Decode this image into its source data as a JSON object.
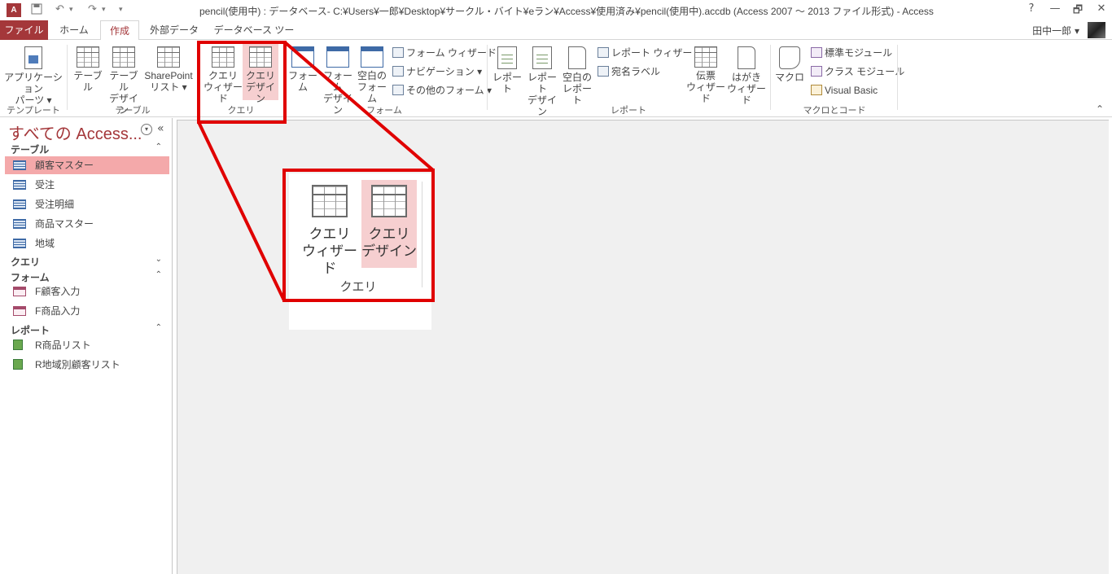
{
  "titlebar": {
    "app_icon": "A",
    "title": "pencil(使用中) : データベース- C:¥Users¥一郎¥Desktop¥サークル・バイト¥eラン¥Access¥使用済み¥pencil(使用中).accdb (Access 2007 ～ 2013 ファイル形式) - Access",
    "save_icon": "save-icon",
    "undo_icon": "undo-icon",
    "redo_icon": "redo-icon",
    "help": "?",
    "restore": "🗗",
    "minimize": "—",
    "close": "✕"
  },
  "tabs": [
    {
      "label": "ファイル"
    },
    {
      "label": "ホーム"
    },
    {
      "label": "作成"
    },
    {
      "label": "外部データ"
    },
    {
      "label": "データベース ツール"
    }
  ],
  "user": {
    "name": "田中一郎 ▾"
  },
  "ribbon": {
    "groups": {
      "template": "テンプレート",
      "table": "テーブル",
      "query": "クエリ",
      "form": "フォーム",
      "report": "レポート",
      "macro": "マクロとコード"
    },
    "app_parts": {
      "line1": "アプリケーション",
      "line2": "パーツ ▾"
    },
    "table": {
      "line1": "テーブル"
    },
    "table_design": {
      "line1": "テーブル",
      "line2": "デザイン"
    },
    "sharepoint": {
      "line1": "SharePoint",
      "line2": "リスト ▾"
    },
    "query_wizard": {
      "line1": "クエリ",
      "line2": "ウィザード"
    },
    "query_design": {
      "line1": "クエリ",
      "line2": "デザイン"
    },
    "form": {
      "line1": "フォーム"
    },
    "form_design": {
      "line1": "フォーム",
      "line2": "デザイン"
    },
    "blank_form": {
      "line1": "空白の",
      "line2": "フォーム"
    },
    "form_wizard": "フォーム ウィザード",
    "navigation": "ナビゲーション ▾",
    "more_forms": "その他のフォーム ▾",
    "report": {
      "line1": "レポート"
    },
    "report_design": {
      "line1": "レポート",
      "line2": "デザイン"
    },
    "blank_report": {
      "line1": "空白の",
      "line2": "レポート"
    },
    "report_wizard": "レポート ウィザード",
    "labels": "宛名ラベル",
    "slip_wizard": {
      "line1": "伝票",
      "line2": "ウィザード"
    },
    "postcard_wizard": {
      "line1": "はがき",
      "line2": "ウィザード"
    },
    "macro": {
      "line1": "マクロ"
    },
    "module": "標準モジュール",
    "class_module": "クラス モジュール",
    "visual_basic": "Visual Basic",
    "collapse": "⌃"
  },
  "navpane": {
    "title": "すべての Access...",
    "menu": "▾",
    "shutter": "«",
    "groups": [
      {
        "label": "テーブル",
        "chevron": "⌃"
      },
      {
        "label": "クエリ",
        "chevron": "⌄"
      },
      {
        "label": "フォーム",
        "chevron": "⌃"
      },
      {
        "label": "レポート",
        "chevron": "⌃"
      }
    ],
    "tables": [
      "顧客マスター",
      "受注",
      "受注明細",
      "商品マスター",
      "地域"
    ],
    "forms": [
      "F顧客入力",
      "F商品入力"
    ],
    "reports": [
      "R商品リスト",
      "R地域別顧客リスト"
    ]
  },
  "zoom": {
    "query_wizard": {
      "line1": "クエリ",
      "line2": "ウィザード"
    },
    "query_design": {
      "line1": "クエリ",
      "line2": "デザイン"
    },
    "group_label": "クエリ"
  },
  "colors": {
    "accent": "#a4373a",
    "highlight": "#f4a9aa",
    "callout": "#e00000"
  }
}
